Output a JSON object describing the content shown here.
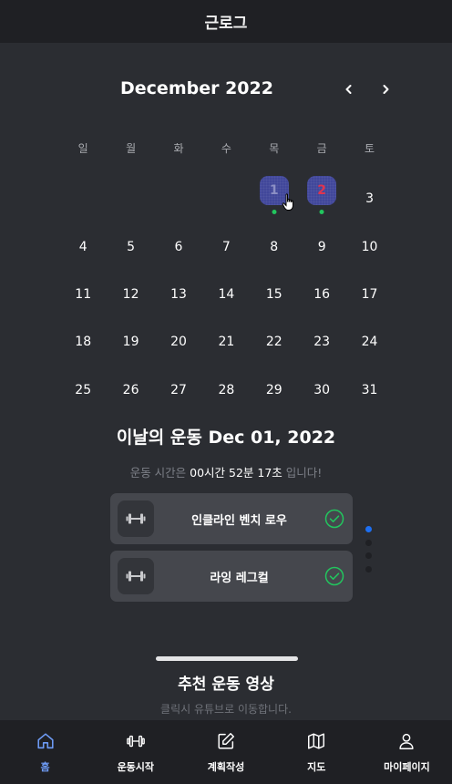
{
  "header": {
    "title": "근로그"
  },
  "calendar": {
    "month_label": "December 2022",
    "weekdays": [
      "일",
      "월",
      "화",
      "수",
      "목",
      "금",
      "토"
    ],
    "days": [
      "1",
      "2",
      "3",
      "4",
      "5",
      "6",
      "7",
      "8",
      "9",
      "10",
      "11",
      "12",
      "13",
      "14",
      "15",
      "16",
      "17",
      "18",
      "19",
      "20",
      "21",
      "22",
      "23",
      "24",
      "25",
      "26",
      "27",
      "28",
      "29",
      "30",
      "31"
    ],
    "workout_days": [
      "1",
      "2"
    ],
    "sunday_highlight_color": "#e0344f",
    "marked_bg_color": "#41479a",
    "dot_color": "#22c55e"
  },
  "today_workout": {
    "title": "이날의 운동 Dec 01, 2022",
    "duration_prefix": "운동 시간은 ",
    "duration_value": "00시간 52분 17초",
    "duration_suffix": " 입니다!",
    "exercises": [
      {
        "name": "인클라인 벤치 로우",
        "icon": "dumbbell-icon",
        "done": true
      },
      {
        "name": "라잉 레그컬",
        "icon": "dumbbell-icon",
        "done": true
      }
    ],
    "pager": {
      "count": 4,
      "active": 0
    }
  },
  "recommend": {
    "title": "추천 운동 영상",
    "subtitle": "클릭시 유튜브로 이동합니다."
  },
  "bottom_nav": {
    "items": [
      {
        "label": "홈",
        "icon": "home-icon",
        "active": true
      },
      {
        "label": "운동시작",
        "icon": "dumbbell-icon",
        "active": false
      },
      {
        "label": "계획작성",
        "icon": "pencil-icon",
        "active": false
      },
      {
        "label": "지도",
        "icon": "map-icon",
        "active": false
      },
      {
        "label": "마이페이지",
        "icon": "user-icon",
        "active": false
      }
    ],
    "active_color": "#6e9bf5"
  }
}
